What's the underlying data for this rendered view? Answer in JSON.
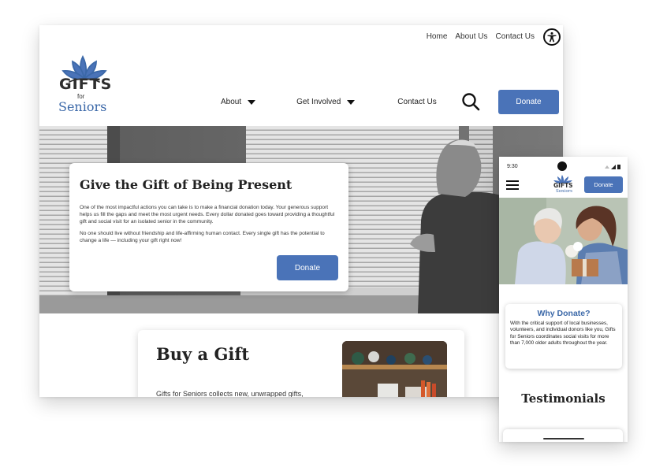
{
  "desktop": {
    "utility_nav": [
      "Home",
      "About Us",
      "Contact Us"
    ],
    "logo": {
      "gifts": "GIFTS",
      "for": "for",
      "seniors": "Seniors"
    },
    "main_nav": {
      "about": "About",
      "get_involved": "Get Involved",
      "contact": "Contact Us"
    },
    "donate_label": "Donate",
    "hero": {
      "title": "Give the Gift of Being Present",
      "paragraph1": "One of the most impactful actions you can take is to make a financial donation today. Your generous support helps us fill the gaps and meet the most urgent needs.  Every dollar donated goes toward providing a thoughtful gift and social visit for an isolated senior in the community.",
      "paragraph2": "No one should live without friendship and life-affirming human contact. Every single gift has the potential to change a life — including your gift right now!",
      "donate_label": "Donate"
    },
    "gift_section": {
      "title": "Buy a Gift",
      "text": "Gifts for Seniors collects new, unwrapped gifts,"
    }
  },
  "mobile": {
    "time": "9:30",
    "logo": {
      "gifts": "GIFTS",
      "seniors": "Seniors"
    },
    "donate_label": "Donate",
    "why": {
      "title": "Why Donate?",
      "text": "With the critical support of local businesses, volunteers, and individual donors like you, Gifts for Seniors coordinates social visits for more than 7,000 older adults throughout the year."
    },
    "testimonials_title": "Testimonials"
  },
  "colors": {
    "brand_blue": "#4a73b8",
    "logo_blue": "#3b68a8"
  },
  "icons": [
    "accessibility-icon",
    "search-icon",
    "caret-down-icon",
    "hamburger-menu-icon",
    "flower-logo-icon"
  ]
}
